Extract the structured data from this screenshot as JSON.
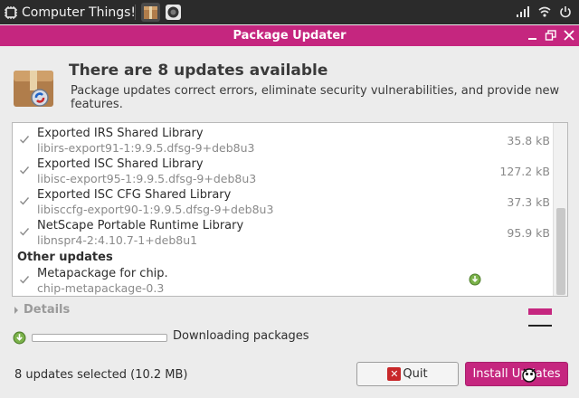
{
  "panel": {
    "menu_label": "Computer Things!",
    "tray_icons": [
      "signal-bars-icon",
      "wifi-icon",
      "power-icon"
    ]
  },
  "window": {
    "title": "Package Updater",
    "controls": [
      "minimize-icon",
      "maximize-icon",
      "close-icon"
    ]
  },
  "header": {
    "heading": "There are 8 updates available",
    "description": "Package updates correct errors, eliminate security vulnerabilities, and provide new features."
  },
  "updates": [
    {
      "name": "Exported IRS Shared Library",
      "package": "libirs-export91-1:9.9.5.dfsg-9+deb8u3",
      "size": "35.8 kB",
      "checked": true
    },
    {
      "name": "Exported ISC Shared Library",
      "package": "libisc-export95-1:9.9.5.dfsg-9+deb8u3",
      "size": "127.2 kB",
      "checked": true
    },
    {
      "name": "Exported ISC CFG Shared Library",
      "package": "libisccfg-export90-1:9.9.5.dfsg-9+deb8u3",
      "size": "37.3 kB",
      "checked": true
    },
    {
      "name": "NetScape Portable Runtime Library",
      "package": "libnspr4-2:4.10.7-1+deb8u1",
      "size": "95.9 kB",
      "checked": true
    }
  ],
  "other_section": {
    "title": "Other updates",
    "items": [
      {
        "name": "Metapackage for chip.",
        "package": "chip-metapackage-0.3",
        "size": "",
        "checked": true,
        "downloading": true
      }
    ]
  },
  "details": {
    "label": "Details"
  },
  "progress": {
    "label": "Downloading packages",
    "fraction": 0.0
  },
  "footer": {
    "summary": "8 updates selected (10.2 MB)",
    "quit_label": "Quit",
    "install_label": "Install Updates"
  },
  "colors": {
    "accent": "#c5267f",
    "panel": "#2b2b2b",
    "quit_icon": "#c8282a"
  }
}
